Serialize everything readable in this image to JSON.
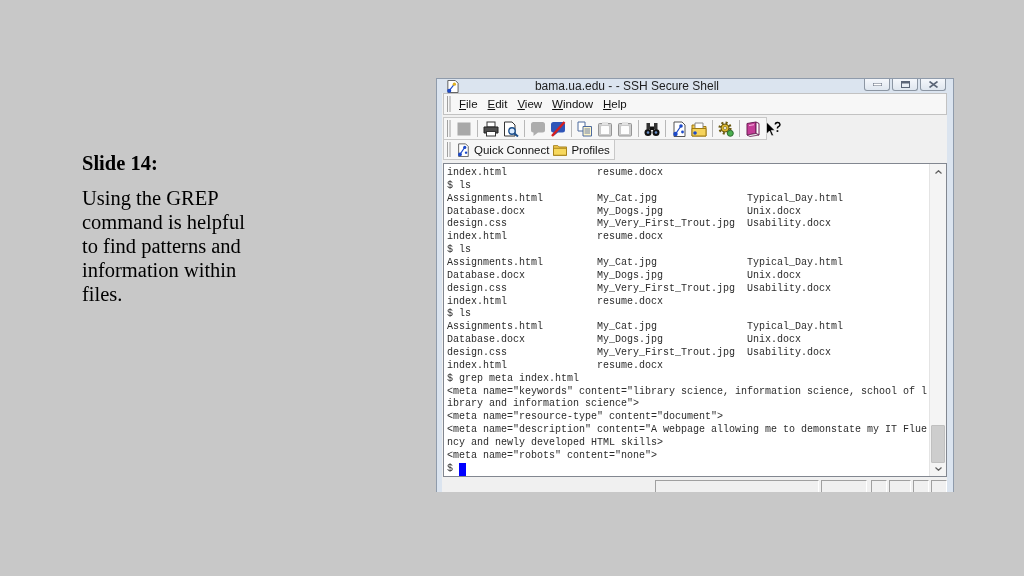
{
  "slide": {
    "heading": "Slide 14:",
    "body": "Using the GREP command is helpful to find patterns and information within files."
  },
  "window": {
    "title": "bama.ua.edu - - SSH Secure Shell"
  },
  "menu": [
    "File",
    "Edit",
    "View",
    "Window",
    "Help"
  ],
  "toolbar": {
    "groups": [
      {
        "buttons": [
          {
            "disabled": true
          }
        ]
      },
      {
        "buttons": [
          {
            "disabled": false
          },
          {
            "disabled": false
          }
        ]
      },
      {
        "buttons": [
          {
            "disabled": true
          },
          {
            "disabled": false
          }
        ]
      },
      {
        "buttons": [
          {
            "disabled": false
          },
          {
            "disabled": true
          },
          {
            "disabled": true
          }
        ]
      },
      {
        "buttons": [
          {
            "disabled": false
          }
        ]
      },
      {
        "buttons": [
          {
            "disabled": false
          },
          {
            "disabled": false
          }
        ]
      },
      {
        "buttons": [
          {
            "disabled": false
          }
        ]
      },
      {
        "buttons": [
          {
            "disabled": false
          },
          {
            "disabled": false
          }
        ]
      }
    ]
  },
  "quick_bar": [
    {
      "label": "Quick Connect"
    },
    {
      "label": "Profiles"
    }
  ],
  "terminal": {
    "lines": [
      "index.html               resume.docx",
      "$ ls",
      "Assignments.html         My_Cat.jpg               Typical_Day.html",
      "Database.docx            My_Dogs.jpg              Unix.docx",
      "design.css               My_Very_First_Trout.jpg  Usability.docx",
      "index.html               resume.docx",
      "$ ls",
      "Assignments.html         My_Cat.jpg               Typical_Day.html",
      "Database.docx            My_Dogs.jpg              Unix.docx",
      "design.css               My_Very_First_Trout.jpg  Usability.docx",
      "index.html               resume.docx",
      "$ ls",
      "Assignments.html         My_Cat.jpg               Typical_Day.html",
      "Database.docx            My_Dogs.jpg              Unix.docx",
      "design.css               My_Very_First_Trout.jpg  Usability.docx",
      "index.html               resume.docx",
      "$ grep meta index.html",
      "<meta name=\"keywords\" content=\"library science, information science, school of l",
      "ibrary and information science\">",
      "<meta name=\"resource-type\" content=\"document\">",
      "<meta name=\"description\" content=\"A webpage allowing me to demonstate my IT Flue",
      "ncy and newly developed HTML skills>",
      "<meta name=\"robots\" content=\"none\">"
    ],
    "prompt": "$"
  }
}
